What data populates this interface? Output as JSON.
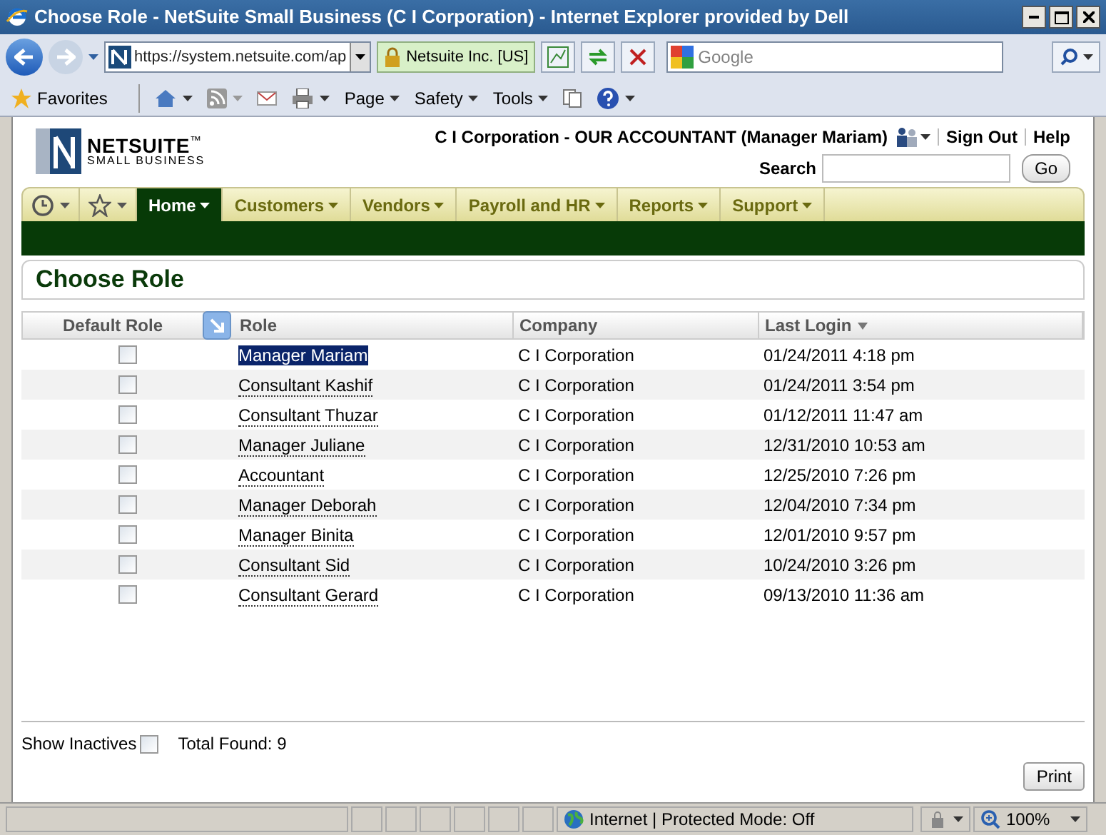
{
  "window": {
    "title": "Choose Role - NetSuite Small Business (C I Corporation) - Internet Explorer provided by Dell"
  },
  "browser": {
    "address": "https://system.netsuite.com/ap",
    "site_identity": "Netsuite Inc. [US]",
    "search_placeholder": "Google",
    "command_bar": [
      "Favorites",
      "Page",
      "Safety",
      "Tools"
    ]
  },
  "header": {
    "logo_name": "NETSUITE",
    "logo_tm": "™",
    "logo_sub": "SMALL BUSINESS",
    "account": "C I Corporation - OUR ACCOUNTANT (Manager Mariam)",
    "links": [
      "Sign Out",
      "Help"
    ],
    "search_label": "Search",
    "go_button": "Go"
  },
  "nav_tabs": [
    {
      "label": "Home",
      "selected": true
    },
    {
      "label": "Customers",
      "selected": false
    },
    {
      "label": "Vendors",
      "selected": false
    },
    {
      "label": "Payroll and HR",
      "selected": false
    },
    {
      "label": "Reports",
      "selected": false
    },
    {
      "label": "Support",
      "selected": false
    }
  ],
  "page_title": "Choose Role",
  "table": {
    "columns": [
      "Default Role",
      "Role",
      "Company",
      "Last Login"
    ],
    "rows": [
      {
        "checked": false,
        "selected": true,
        "role": "Manager Mariam",
        "company": "C I Corporation",
        "last_login": "01/24/2011 4:18 pm"
      },
      {
        "checked": false,
        "selected": false,
        "role": "Consultant Kashif",
        "company": "C I Corporation",
        "last_login": "01/24/2011 3:54 pm"
      },
      {
        "checked": false,
        "selected": false,
        "role": "Consultant Thuzar",
        "company": "C I Corporation",
        "last_login": "01/12/2011 11:47 am"
      },
      {
        "checked": false,
        "selected": false,
        "role": "Manager Juliane",
        "company": "C I Corporation",
        "last_login": "12/31/2010 10:53 am"
      },
      {
        "checked": false,
        "selected": false,
        "role": "Accountant",
        "company": "C I Corporation",
        "last_login": "12/25/2010 7:26 pm"
      },
      {
        "checked": false,
        "selected": false,
        "role": "Manager Deborah",
        "company": "C I Corporation",
        "last_login": "12/04/2010 7:34 pm"
      },
      {
        "checked": false,
        "selected": false,
        "role": "Manager Binita",
        "company": "C I Corporation",
        "last_login": "12/01/2010 9:57 pm"
      },
      {
        "checked": false,
        "selected": false,
        "role": "Consultant Sid",
        "company": "C I Corporation",
        "last_login": "10/24/2010 3:26 pm"
      },
      {
        "checked": false,
        "selected": false,
        "role": "Consultant Gerard",
        "company": "C I Corporation",
        "last_login": "09/13/2010 11:36 am"
      }
    ]
  },
  "footer": {
    "show_inactives": {
      "label": "Show Inactives",
      "checked": false
    },
    "total": "Total Found: 9",
    "print_button": "Print"
  },
  "status_bar": {
    "zone": "Internet | Protected Mode: Off",
    "zoom": "100%"
  }
}
